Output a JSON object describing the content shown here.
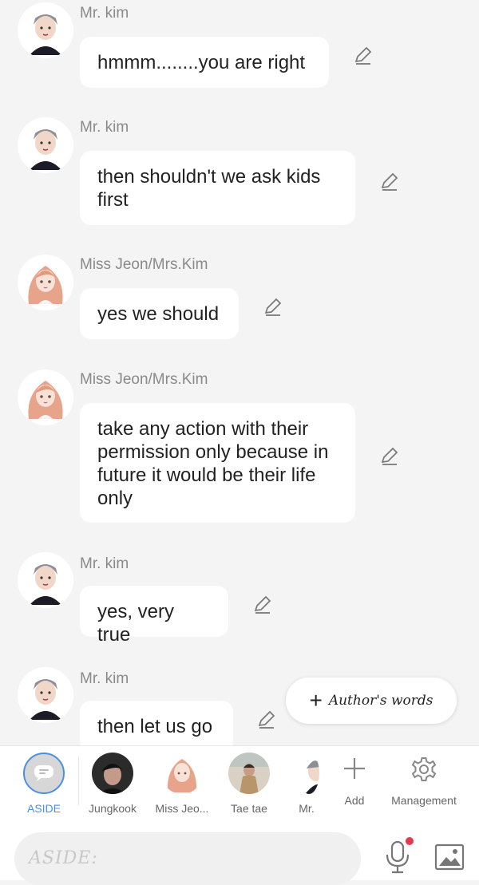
{
  "messages": [
    {
      "name": "Mr. kim",
      "text": "hmmm........you are right",
      "avatar": "mr-kim"
    },
    {
      "name": "Mr. kim",
      "text": "then shouldn't we ask kids first",
      "avatar": "mr-kim"
    },
    {
      "name": "Miss Jeon/Mrs.Kim",
      "text": "yes we should",
      "avatar": "miss-jeon"
    },
    {
      "name": "Miss Jeon/Mrs.Kim",
      "text": "take any action with their permission only because in future it would be their life only",
      "avatar": "miss-jeon"
    },
    {
      "name": "Mr. kim",
      "text": "yes, very true",
      "avatar": "mr-kim"
    },
    {
      "name": "Mr. kim",
      "text": "then let us go",
      "avatar": "mr-kim"
    }
  ],
  "fab": {
    "plus": "+",
    "label": "Author's words"
  },
  "cast_bar": {
    "aside_label": "ASIDE",
    "characters": [
      {
        "label": "Jungkook"
      },
      {
        "label": "Miss Jeo..."
      },
      {
        "label": "Tae tae"
      },
      {
        "label": "Mr."
      }
    ],
    "add_label": "Add",
    "management_label": "Management"
  },
  "input": {
    "placeholder": "ASIDE:"
  },
  "colors": {
    "accent": "#4a90e2",
    "record_dot": "#e53950",
    "background": "#f4f4f4"
  }
}
